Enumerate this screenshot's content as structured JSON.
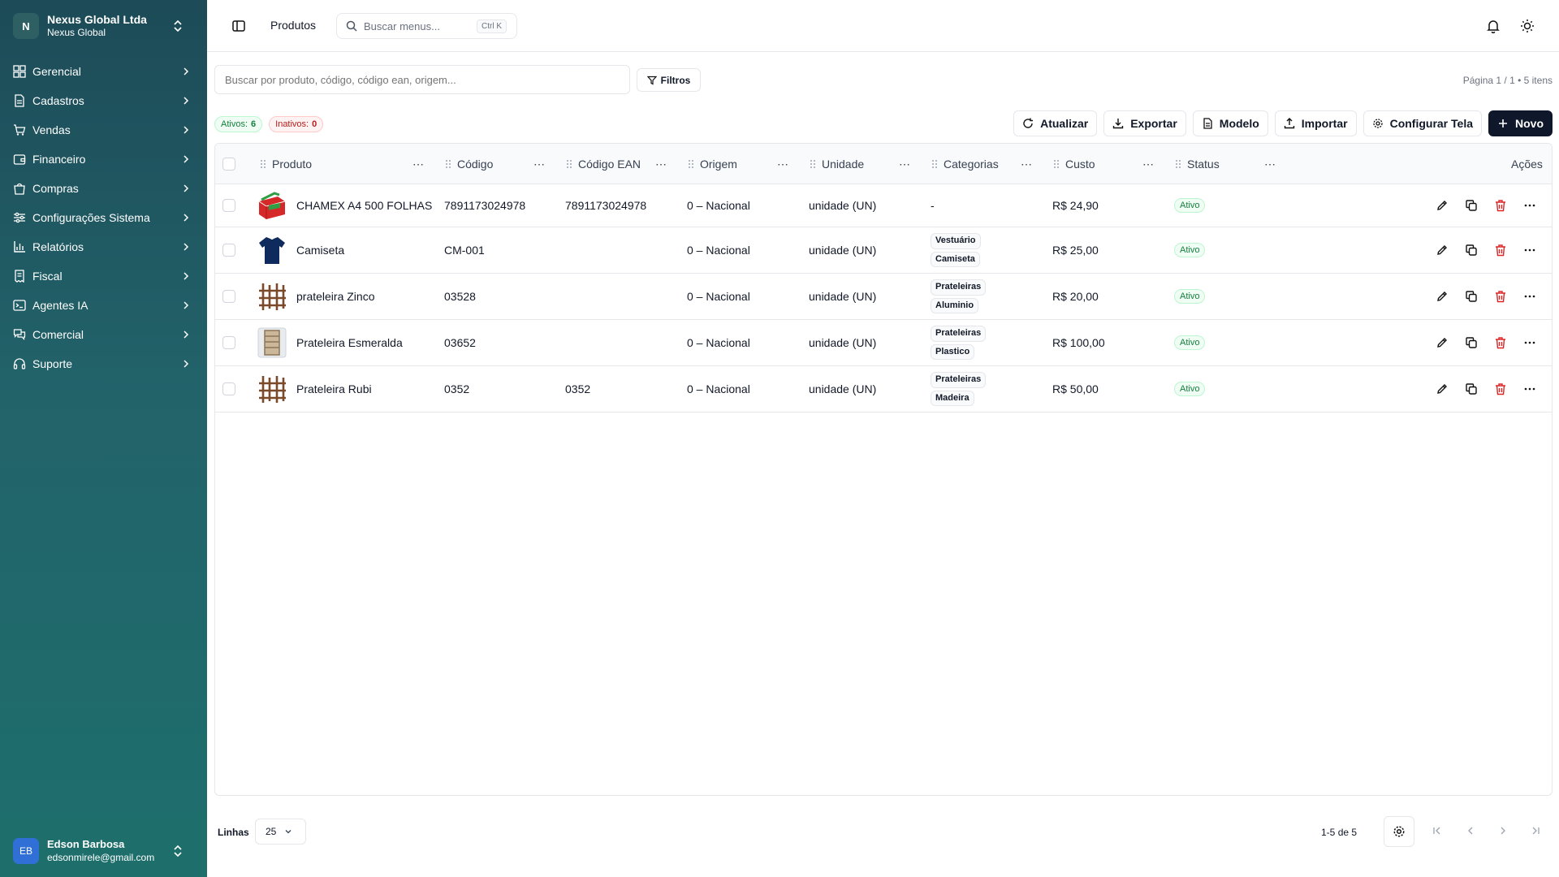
{
  "sidebar": {
    "org_initial": "N",
    "org_name": "Nexus Global Ltda",
    "org_sub": "Nexus Global",
    "items": [
      {
        "label": "Gerencial",
        "icon": "dashboard-icon"
      },
      {
        "label": "Cadastros",
        "icon": "document-icon"
      },
      {
        "label": "Vendas",
        "icon": "cart-icon"
      },
      {
        "label": "Financeiro",
        "icon": "wallet-icon"
      },
      {
        "label": "Compras",
        "icon": "shopping-bag-icon"
      },
      {
        "label": "Configurações Sistema",
        "icon": "sliders-icon"
      },
      {
        "label": "Relatórios",
        "icon": "bar-chart-icon"
      },
      {
        "label": "Fiscal",
        "icon": "receipt-icon"
      },
      {
        "label": "Agentes IA",
        "icon": "terminal-icon"
      },
      {
        "label": "Comercial",
        "icon": "chat-icon"
      },
      {
        "label": "Suporte",
        "icon": "headset-icon"
      }
    ],
    "user_initials": "EB",
    "user_name": "Edson Barbosa",
    "user_email": "edsonmirele@gmail.com"
  },
  "topbar": {
    "title": "Produtos",
    "search_placeholder": "Buscar menus...",
    "shortcut": "Ctrl K"
  },
  "toolbar": {
    "search_placeholder": "Buscar por produto, código, código ean, origem...",
    "filters_label": "Filtros",
    "page_info": "Página 1 / 1 • 5 itens",
    "active_label": "Ativos:",
    "active_count": "6",
    "inactive_label": "Inativos:",
    "inactive_count": "0",
    "buttons": {
      "refresh": "Atualizar",
      "export": "Exportar",
      "template": "Modelo",
      "import": "Importar",
      "configure": "Configurar Tela",
      "new": "Novo"
    }
  },
  "table": {
    "columns": {
      "product": "Produto",
      "code": "Código",
      "ean": "Código EAN",
      "origin": "Origem",
      "unit": "Unidade",
      "categories": "Categorias",
      "cost": "Custo",
      "status": "Status",
      "actions": "Ações"
    },
    "rows": [
      {
        "product": "CHAMEX A4 500 FOLHAS",
        "code": "7891173024978",
        "ean": "7891173024978",
        "origin": "0 – Nacional",
        "unit": "unidade (UN)",
        "categories": [],
        "no_category": "-",
        "cost": "R$ 24,90",
        "status": "Ativo",
        "thumb": "paper-ream"
      },
      {
        "product": "Camiseta",
        "code": "CM-001",
        "ean": "",
        "origin": "0 – Nacional",
        "unit": "unidade (UN)",
        "categories": [
          "Vestuário",
          "Camiseta"
        ],
        "cost": "R$ 25,00",
        "status": "Ativo",
        "thumb": "tshirt"
      },
      {
        "product": "prateleira Zinco",
        "code": "03528",
        "ean": "",
        "origin": "0 – Nacional",
        "unit": "unidade (UN)",
        "categories": [
          "Prateleiras",
          "Aluminio"
        ],
        "cost": "R$ 20,00",
        "status": "Ativo",
        "thumb": "shelf"
      },
      {
        "product": "Prateleira Esmeralda",
        "code": "03652",
        "ean": "",
        "origin": "0 – Nacional",
        "unit": "unidade (UN)",
        "categories": [
          "Prateleiras",
          "Plastico"
        ],
        "cost": "R$ 100,00",
        "status": "Ativo",
        "thumb": "cabinet"
      },
      {
        "product": "Prateleira Rubi",
        "code": "0352",
        "ean": "0352",
        "origin": "0 – Nacional",
        "unit": "unidade (UN)",
        "categories": [
          "Prateleiras",
          "Madeira"
        ],
        "cost": "R$ 50,00",
        "status": "Ativo",
        "thumb": "shelf"
      }
    ]
  },
  "footer": {
    "rows_label": "Linhas",
    "rows_value": "25",
    "range": "1-5",
    "range_of": "de 5"
  }
}
